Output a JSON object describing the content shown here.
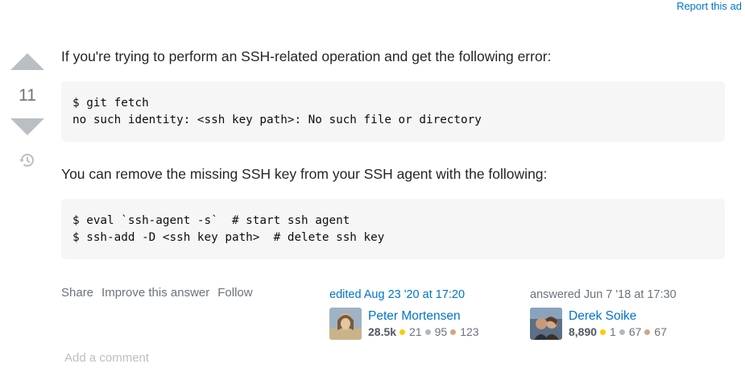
{
  "report_ad": "Report this ad",
  "vote": {
    "count": "11"
  },
  "post": {
    "para1": "If you're trying to perform an SSH-related operation and get the following error:",
    "code1": "$ git fetch\nno such identity: <ssh key path>: No such file or directory",
    "para2": "You can remove the missing SSH key from your SSH agent with the following:",
    "code2": "$ eval `ssh-agent -s`  # start ssh agent\n$ ssh-add -D <ssh key path>  # delete ssh key"
  },
  "actions": {
    "share": "Share",
    "improve": "Improve this answer",
    "follow": "Follow"
  },
  "editor": {
    "time": "edited Aug 23 '20 at 17:20",
    "name": "Peter Mortensen",
    "rep": "28.5k",
    "gold": "21",
    "silver": "95",
    "bronze": "123"
  },
  "author": {
    "time": "answered Jun 7 '18 at 17:30",
    "name": "Derek Soike",
    "rep": "8,890",
    "gold": "1",
    "silver": "67",
    "bronze": "67"
  },
  "add_comment": "Add a comment",
  "colors": {
    "link": "#0074cc",
    "muted": "#6a737c",
    "code_bg": "#f6f6f6"
  }
}
